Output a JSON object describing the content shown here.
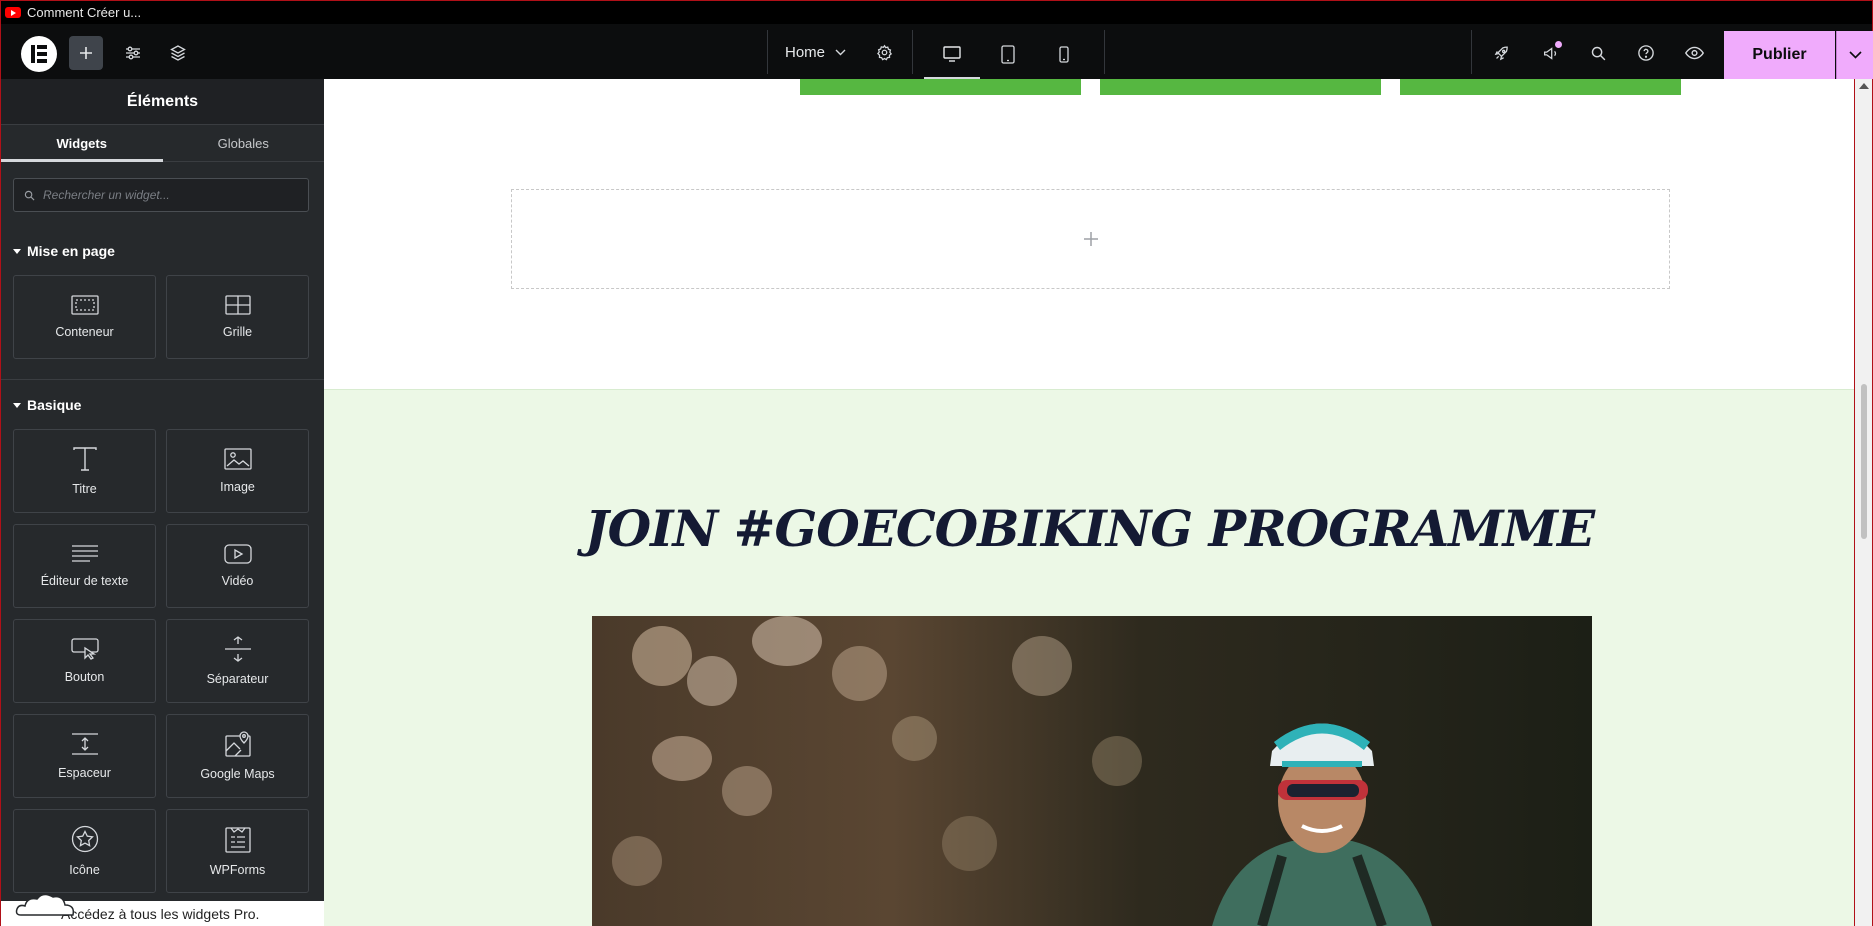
{
  "window": {
    "title": "Comment Créer u..."
  },
  "topbar": {
    "page_name": "Home",
    "publish_label": "Publier"
  },
  "panel": {
    "title": "Éléments",
    "tabs": [
      "Widgets",
      "Globales"
    ],
    "search_placeholder": "Rechercher un widget...",
    "sections": [
      {
        "title": "Mise en page",
        "widgets": [
          "Conteneur",
          "Grille"
        ]
      },
      {
        "title": "Basique",
        "widgets": [
          "Titre",
          "Image",
          "Éditeur de texte",
          "Vidéo",
          "Bouton",
          "Séparateur",
          "Espaceur",
          "Google Maps",
          "Icône",
          "WPForms"
        ]
      }
    ],
    "promo_text": "Accédez à tous les widgets Pro."
  },
  "canvas": {
    "heading": "JOIN #GOECOBIKING PROGRAMME"
  },
  "colors": {
    "accent_publish": "#f0abfc",
    "brand_green": "#56b741",
    "section_bg": "#ecf8e6",
    "heading": "#141a33"
  }
}
